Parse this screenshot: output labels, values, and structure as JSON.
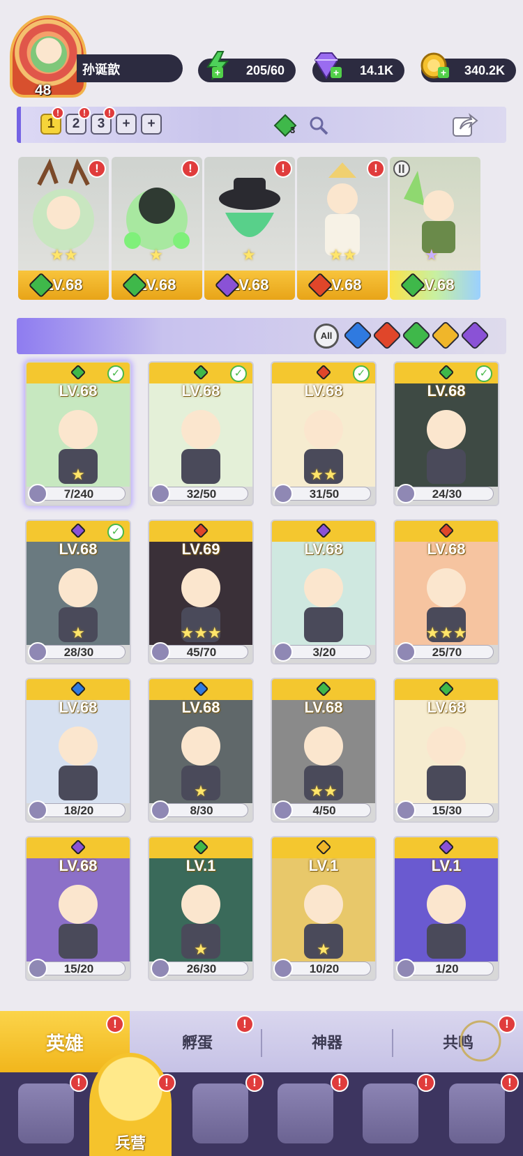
{
  "player": {
    "level": "48",
    "name": "孙诞歆"
  },
  "resources": [
    {
      "name": "energy",
      "icon": "lightning-icon",
      "value": "205/60",
      "color": "#4ed15a"
    },
    {
      "name": "gems",
      "icon": "diamond-icon",
      "value": "14.1K",
      "color": "#9a6cf0"
    },
    {
      "name": "gold",
      "icon": "coin-icon",
      "value": "340.2K",
      "color": "#f5c12e"
    }
  ],
  "team_bar": {
    "tabs": [
      "1",
      "2",
      "3"
    ],
    "active_tab": "1",
    "badge_text": "!",
    "element_gem_count": "3"
  },
  "team": [
    {
      "level": "LV.68",
      "element": "nature",
      "stars": "★★",
      "badge": "!"
    },
    {
      "level": "LV.68",
      "element": "nature",
      "stars": "★",
      "badge": "!"
    },
    {
      "level": "LV.68",
      "element": "dark",
      "stars": "★",
      "badge": "!"
    },
    {
      "level": "LV.68",
      "element": "fire",
      "stars": "★★",
      "badge": "!"
    },
    {
      "level": "LV.68",
      "element": "nature",
      "stars": "★",
      "badge": ""
    }
  ],
  "filter": {
    "all_label": "All"
  },
  "elements": {
    "nature": "#3fb84a",
    "dark": "#8a52d6",
    "fire": "#e0462a",
    "water": "#2f7ae0",
    "light": "#f0b62a"
  },
  "heroes": [
    {
      "level": "LV.68",
      "element": "nature",
      "frag": "7/240",
      "check": true,
      "stars": "★"
    },
    {
      "level": "LV.68",
      "element": "nature",
      "frag": "32/50",
      "check": true,
      "stars": ""
    },
    {
      "level": "LV.68",
      "element": "fire",
      "frag": "31/50",
      "check": true,
      "stars": "★★"
    },
    {
      "level": "LV.68",
      "element": "nature",
      "frag": "24/30",
      "check": true,
      "stars": ""
    },
    {
      "level": "LV.68",
      "element": "dark",
      "frag": "28/30",
      "check": true,
      "stars": "★"
    },
    {
      "level": "LV.69",
      "element": "fire",
      "frag": "45/70",
      "check": false,
      "stars": "★★★"
    },
    {
      "level": "LV.68",
      "element": "dark",
      "frag": "3/20",
      "check": false,
      "stars": ""
    },
    {
      "level": "LV.68",
      "element": "fire",
      "frag": "25/70",
      "check": false,
      "stars": "★★★"
    },
    {
      "level": "LV.68",
      "element": "water",
      "frag": "18/20",
      "check": false,
      "stars": ""
    },
    {
      "level": "LV.68",
      "element": "water",
      "frag": "8/30",
      "check": false,
      "stars": "★"
    },
    {
      "level": "LV.68",
      "element": "nature",
      "frag": "4/50",
      "check": false,
      "stars": "★★"
    },
    {
      "level": "LV.68",
      "element": "nature",
      "frag": "15/30",
      "check": false,
      "stars": ""
    },
    {
      "level": "LV.68",
      "element": "dark",
      "frag": "15/20",
      "check": false,
      "stars": ""
    },
    {
      "level": "LV.1",
      "element": "nature",
      "frag": "26/30",
      "check": false,
      "stars": "★"
    },
    {
      "level": "LV.1",
      "element": "light",
      "frag": "10/20",
      "check": false,
      "stars": "★"
    },
    {
      "level": "LV.1",
      "element": "dark",
      "frag": "1/20",
      "check": false,
      "stars": ""
    }
  ],
  "sub_tabs": [
    {
      "label": "英雄",
      "active": true,
      "badge": "!"
    },
    {
      "label": "孵蛋",
      "active": false,
      "badge": "!"
    },
    {
      "label": "神器",
      "active": false,
      "badge": ""
    },
    {
      "label": "共鸣",
      "active": false,
      "badge": "!"
    }
  ],
  "nav": {
    "active_label": "兵营",
    "items": [
      "cards-icon",
      "barracks-icon",
      "map-book-icon",
      "shrine-icon",
      "mushroom-house-icon",
      "castle-icon"
    ]
  }
}
